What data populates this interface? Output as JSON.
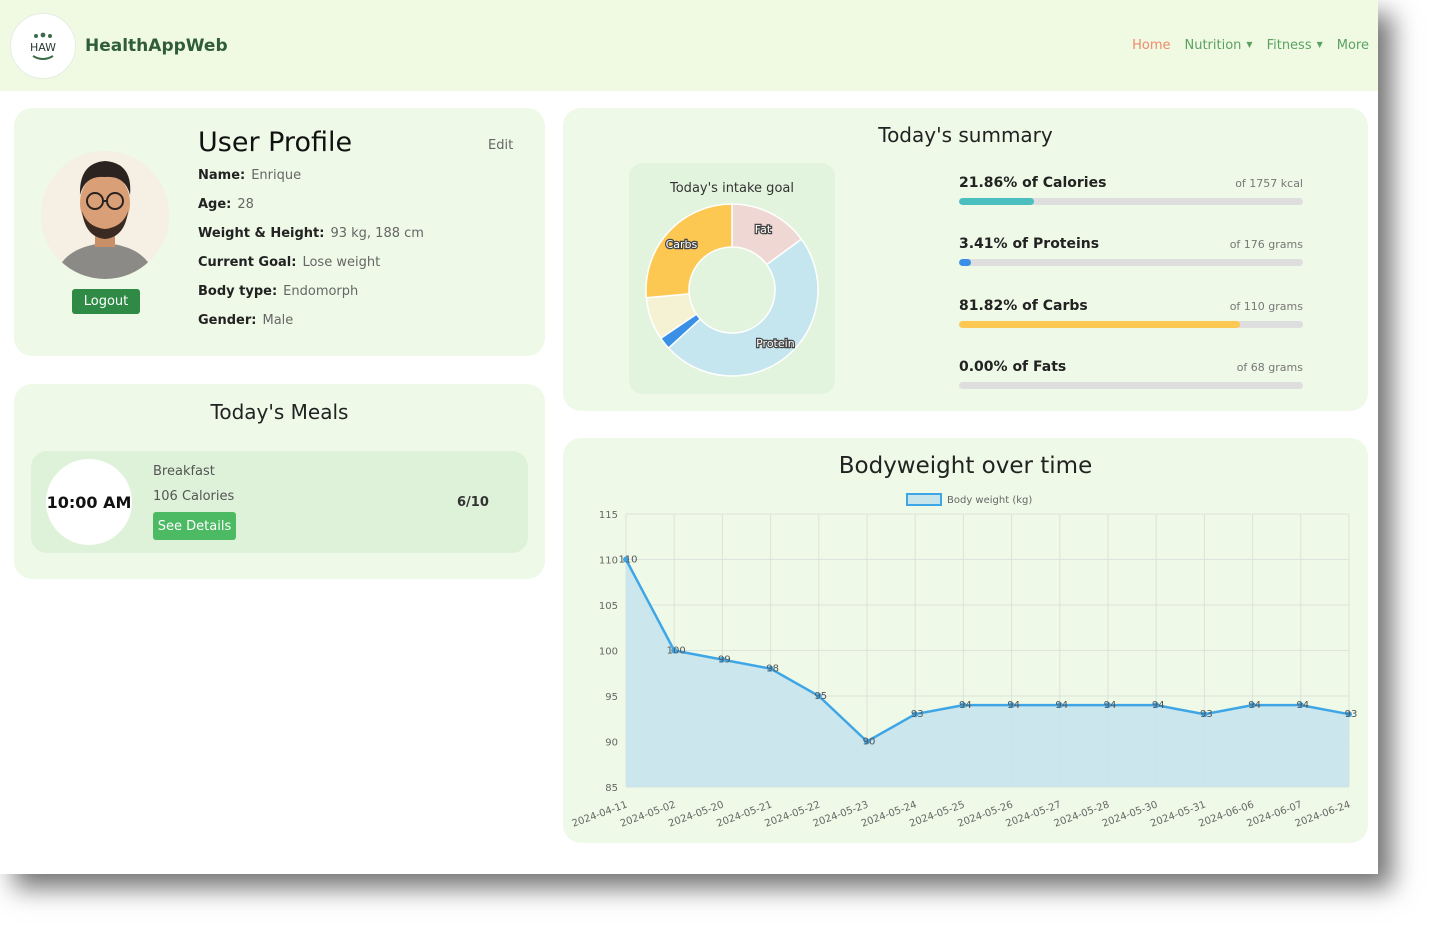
{
  "app": {
    "logo_text": "HAW",
    "name": "HealthAppWeb"
  },
  "nav": {
    "home": "Home",
    "nutrition": "Nutrition",
    "fitness": "Fitness",
    "more": "More"
  },
  "profile": {
    "title": "User Profile",
    "edit": "Edit",
    "logout": "Logout",
    "fields": [
      {
        "label": "Name:",
        "value": "Enrique"
      },
      {
        "label": "Age:",
        "value": "28"
      },
      {
        "label": "Weight & Height:",
        "value": "93 kg, 188 cm"
      },
      {
        "label": "Current Goal:",
        "value": "Lose weight"
      },
      {
        "label": "Body type:",
        "value": "Endomorph"
      },
      {
        "label": "Gender:",
        "value": "Male"
      }
    ]
  },
  "meals": {
    "title": "Today's Meals",
    "items": [
      {
        "time": "10:00 AM",
        "name": "Breakfast",
        "calories": "106 Calories",
        "details": "See Details",
        "score": "6/10"
      }
    ]
  },
  "summary": {
    "title": "Today's summary",
    "donut_title": "Today's intake goal",
    "bars": [
      {
        "label": "21.86% of Calories",
        "of": "of 1757 kcal",
        "pct": 21.86,
        "color": "#4bbfc0"
      },
      {
        "label": "3.41% of Proteins",
        "of": "of 176 grams",
        "pct": 3.41,
        "color": "#3a8fe6"
      },
      {
        "label": "81.82% of Carbs",
        "of": "of 110 grams",
        "pct": 81.82,
        "color": "#fdc851"
      },
      {
        "label": "0.00% of Fats",
        "of": "of 68 grams",
        "pct": 0,
        "color": "#f1a1a1"
      }
    ]
  },
  "chart_data": [
    {
      "type": "pie",
      "title": "Today's intake goal",
      "labels": [
        "Fat",
        "Protein",
        "",
        "",
        "Carbs"
      ],
      "values": [
        13,
        42,
        2,
        7,
        23
      ],
      "colors": [
        "#efd8d3",
        "#c5e6ee",
        "#3a8fe6",
        "#f5f2d4",
        "#fdc851"
      ]
    },
    {
      "type": "line",
      "title": "Bodyweight over time",
      "series": [
        {
          "name": "Body weight (kg)",
          "values": [
            110,
            100,
            99,
            98,
            95,
            90,
            93,
            94,
            94,
            94,
            94,
            94,
            93,
            94,
            94,
            93
          ]
        }
      ],
      "x": [
        "2024-04-11",
        "2024-05-02",
        "2024-05-20",
        "2024-05-21",
        "2024-05-22",
        "2024-05-23",
        "2024-05-24",
        "2024-05-25",
        "2024-05-26",
        "2024-05-27",
        "2024-05-28",
        "2024-05-30",
        "2024-05-31",
        "2024-06-06",
        "2024-06-07",
        "2024-06-24"
      ],
      "ylim": [
        85,
        115
      ],
      "yticks": [
        115,
        110,
        105,
        100,
        95,
        90,
        85
      ],
      "line_color": "#3ea6e6",
      "fill_color": "#c8e5ec",
      "grid": true,
      "legend": "top"
    }
  ]
}
